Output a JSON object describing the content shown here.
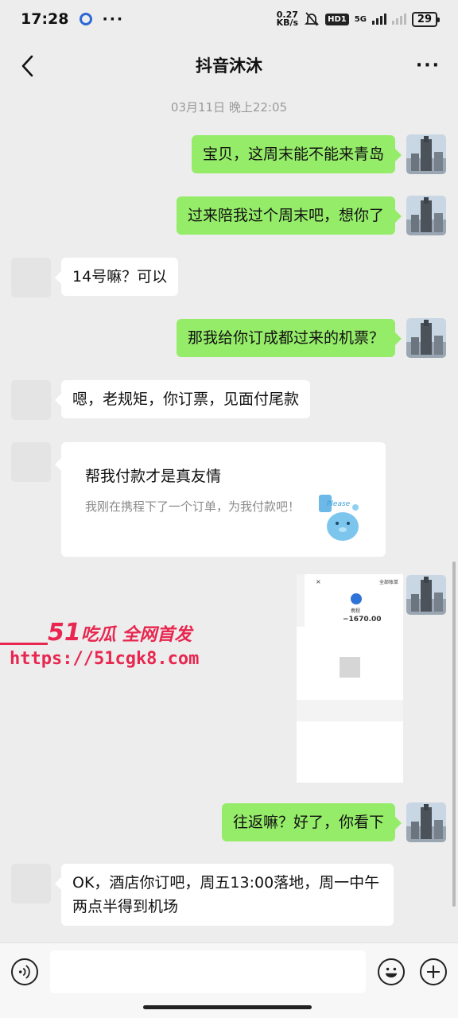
{
  "status": {
    "time": "17:28",
    "net_speed_value": "0.27",
    "net_speed_unit": "KB/s",
    "hd_label": "HD1",
    "network_label": "5G",
    "battery": "29",
    "icons": [
      "app-dot-icon",
      "more-icon",
      "mute-bell-icon",
      "signal-icon",
      "battery-icon"
    ]
  },
  "header": {
    "title": "抖音沐沐",
    "back_icon": "chevron-left-icon",
    "menu_label": "···"
  },
  "timestamp": "03月11日 晚上22:05",
  "messages": [
    {
      "from": "me",
      "text": "宝贝，这周末能不能来青岛"
    },
    {
      "from": "me",
      "text": "过来陪我过个周末吧，想你了"
    },
    {
      "from": "them",
      "text": "14号嘛？可以"
    },
    {
      "from": "me",
      "text": "那我给你订成都过来的机票？"
    },
    {
      "from": "them",
      "text": "嗯，老规矩，你订票，见面付尾款"
    },
    {
      "from": "them",
      "type": "card",
      "title": "帮我付款才是真友情",
      "description": "我刚在携程下了一个订单，为我付款吧！",
      "sticker_text": "Please"
    },
    {
      "from": "me",
      "type": "image",
      "close": "×",
      "tag": "全部账单",
      "brand": "携程",
      "amount": "−1670.00"
    },
    {
      "from": "me",
      "text": "往返嘛？好了，你看下"
    },
    {
      "from": "them",
      "text": "OK，酒店你订吧，周五13:00落地，周一中午两点半得到机场"
    }
  ],
  "watermark": {
    "brand_num": "51",
    "brand_text": "吃瓜 全网首发",
    "url": "https://51cgk8.com"
  },
  "input": {
    "placeholder": "",
    "voice_icon": "voice-icon",
    "emoji_icon": "emoji-icon",
    "plus_icon": "plus-icon"
  },
  "colors": {
    "my_bubble": "#95ec69",
    "their_bubble": "#ffffff",
    "background": "#ededed",
    "watermark": "#e8264f"
  }
}
